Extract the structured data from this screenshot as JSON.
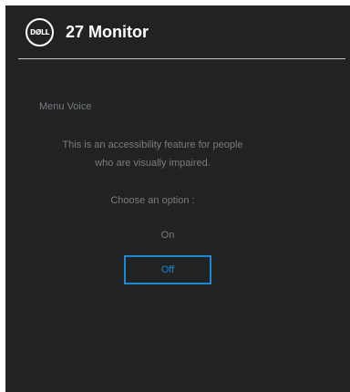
{
  "header": {
    "logo_text": "DØLL",
    "title": "27 Monitor"
  },
  "menu": {
    "section_label": "Menu Voice",
    "description_line1": "This is an accessibility feature for people",
    "description_line2": "who are visually impaired.",
    "prompt": "Choose an option :",
    "options": [
      {
        "label": "On",
        "selected": false
      },
      {
        "label": "Off",
        "selected": true
      }
    ]
  },
  "colors": {
    "background": "#202224",
    "text_primary": "#ffffff",
    "text_muted": "#7a7c7e",
    "accent": "#1e88d0",
    "divider": "#c8c8c8"
  }
}
